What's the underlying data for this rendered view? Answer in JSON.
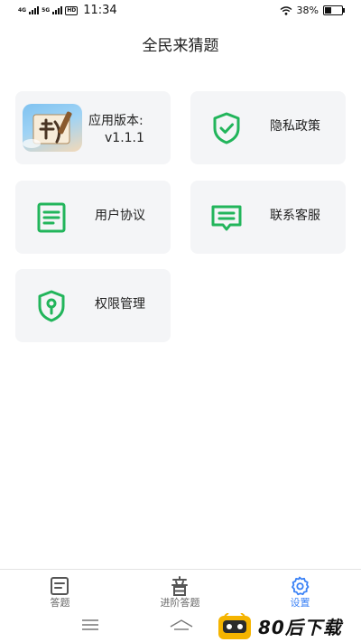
{
  "status_bar": {
    "network_1": "4G",
    "network_2": "5G",
    "hd": "HD",
    "time": "11:34",
    "battery_level": "38%",
    "battery_fraction": 0.38
  },
  "header": {
    "title": "全民来猜题"
  },
  "cards": {
    "version": {
      "label": "应用版本:",
      "value": "v1.1.1"
    },
    "privacy": {
      "label": "隐私政策",
      "icon": "shield-check-icon"
    },
    "agreement": {
      "label": "用户协议",
      "icon": "document-lines-icon"
    },
    "contact": {
      "label": "联系客服",
      "icon": "chat-bubble-icon"
    },
    "permissions": {
      "label": "权限管理",
      "icon": "shield-key-icon"
    }
  },
  "tabbar": {
    "tabs": [
      {
        "label": "答题",
        "icon": "quiz-icon",
        "active": false
      },
      {
        "label": "进阶答题",
        "icon": "yin-character-icon",
        "active": false
      },
      {
        "label": "设置",
        "icon": "gear-icon",
        "active": true
      }
    ]
  },
  "watermark": {
    "text": "80后下载"
  },
  "colors": {
    "accent_green": "#22b55b",
    "active_blue": "#3b82f6",
    "card_bg": "#f4f5f7"
  }
}
